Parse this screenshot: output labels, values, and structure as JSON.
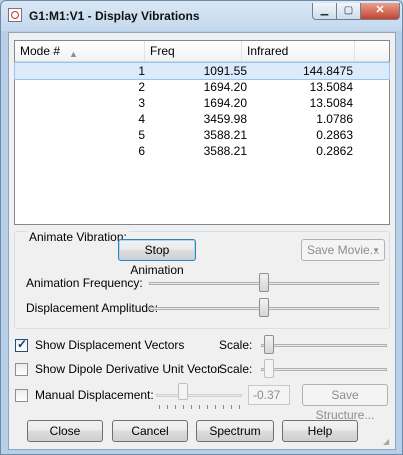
{
  "window": {
    "title": "G1:M1:V1 - Display Vibrations"
  },
  "titlebar": {
    "minimize": "▁",
    "maximize": "▢",
    "close": "✕"
  },
  "table": {
    "headers": {
      "mode": "Mode #",
      "freq": "Freq",
      "infrared": "Infrared"
    },
    "rows": [
      {
        "mode": "1",
        "freq": "1091.55",
        "infrared": "144.8475"
      },
      {
        "mode": "2",
        "freq": "1694.20",
        "infrared": "13.5084"
      },
      {
        "mode": "3",
        "freq": "1694.20",
        "infrared": "13.5084"
      },
      {
        "mode": "4",
        "freq": "3459.98",
        "infrared": "1.0786"
      },
      {
        "mode": "5",
        "freq": "3588.21",
        "infrared": "0.2863"
      },
      {
        "mode": "6",
        "freq": "3588.21",
        "infrared": "0.2862"
      }
    ],
    "selected_row": 1
  },
  "animate": {
    "group_label": "Animate Vibration:",
    "stop_button": "Stop Animation",
    "save_movie_button": "Save Movie...",
    "frequency_label": "Animation Frequency:",
    "frequency_level": 0.5,
    "amplitude_label": "Displacement Amplitude:",
    "amplitude_level": 0.5
  },
  "options": {
    "show_vectors_label": "Show Displacement Vectors",
    "show_vectors_checked": true,
    "vectors_scale_label": "Scale:",
    "vectors_scale_level": 0.0,
    "show_dipole_label": "Show Dipole Derivative Unit Vector",
    "show_dipole_checked": false,
    "dipole_scale_label": "Scale:",
    "dipole_scale_level": 0.0,
    "manual_label": "Manual Displacement:",
    "manual_checked": false,
    "manual_value": "-0.37",
    "save_structure_button": "Save Structure..."
  },
  "buttons": {
    "close": "Close",
    "cancel": "Cancel",
    "spectrum": "Spectrum",
    "help": "Help"
  }
}
